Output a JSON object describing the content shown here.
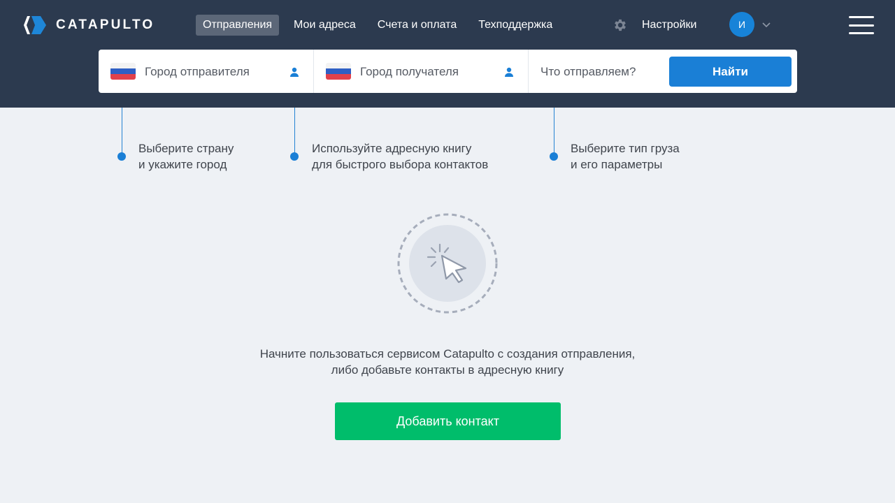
{
  "header": {
    "logo_text": "CATAPULTO",
    "nav": [
      {
        "label": "Отправления",
        "active": true
      },
      {
        "label": "Мои адреса",
        "active": false
      },
      {
        "label": "Счета и оплата",
        "active": false
      },
      {
        "label": "Техподдержка",
        "active": false
      }
    ],
    "settings_label": "Настройки",
    "avatar_initial": "И"
  },
  "search": {
    "from_placeholder": "Город отправителя",
    "to_placeholder": "Город получателя",
    "cargo_placeholder": "Что отправляем?",
    "find_label": "Найти"
  },
  "hints": [
    {
      "line1": "Выберите страну",
      "line2": "и укажите город"
    },
    {
      "line1": "Используйте адресную книгу",
      "line2": "для быстрого выбора контактов"
    },
    {
      "line1": "Выберите тип груза",
      "line2": "и его параметры"
    }
  ],
  "empty_state": {
    "line1": "Начните пользоваться сервисом Catapulto с создания отправления,",
    "line2": "либо добавьте контакты в адресную книгу",
    "button_label": "Добавить контакт"
  },
  "colors": {
    "header_bg": "#2c3a4f",
    "accent_blue": "#1a7fd6",
    "accent_green": "#00bd6b",
    "page_bg": "#eef1f5"
  }
}
